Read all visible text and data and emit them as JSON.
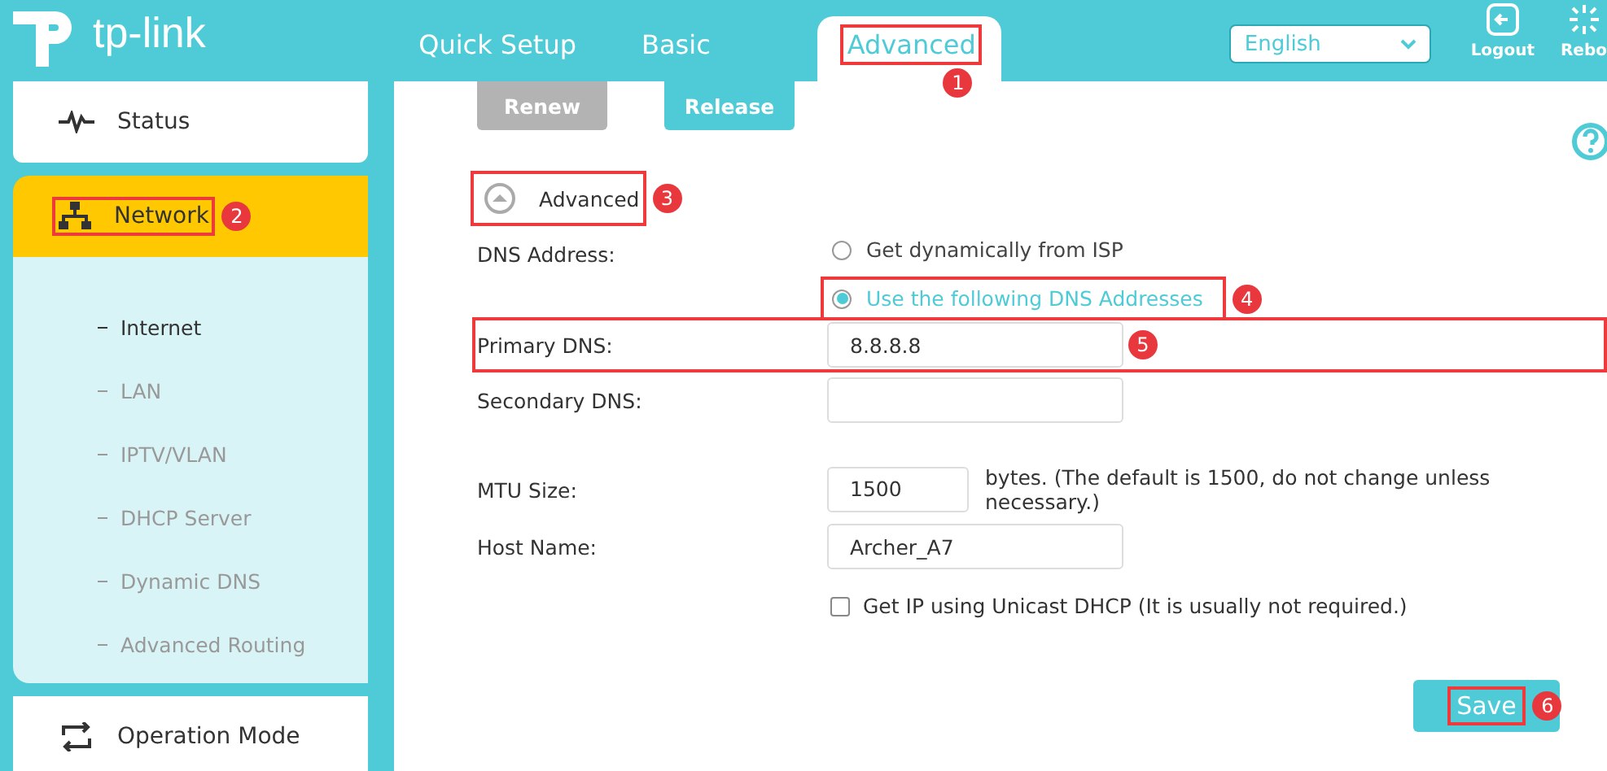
{
  "logo": {
    "text": "tp-link"
  },
  "nav_tabs": [
    {
      "label": "Quick Setup",
      "selected": false
    },
    {
      "label": "Basic",
      "selected": false
    },
    {
      "label": "Advanced",
      "selected": true,
      "annotation": "1"
    }
  ],
  "language": {
    "value": "English"
  },
  "header_actions": [
    {
      "label": "Logout",
      "kind": "logout"
    },
    {
      "label": "Rebo",
      "kind": "reboot"
    }
  ],
  "sidebar": {
    "items": [
      {
        "label": "Status",
        "kind": "status",
        "selected": false
      },
      {
        "label": "Network",
        "kind": "network",
        "selected": true,
        "annotation": "2",
        "children": [
          {
            "label": "Internet",
            "selected": true
          },
          {
            "label": "LAN",
            "selected": false
          },
          {
            "label": "IPTV/VLAN",
            "selected": false
          },
          {
            "label": "DHCP Server",
            "selected": false
          },
          {
            "label": "Dynamic DNS",
            "selected": false
          },
          {
            "label": "Advanced Routing",
            "selected": false
          }
        ]
      },
      {
        "label": "Operation Mode",
        "kind": "mode",
        "selected": false
      }
    ]
  },
  "top_buttons": [
    {
      "label": "Renew",
      "disabled": true
    },
    {
      "label": "Release",
      "disabled": false
    }
  ],
  "advanced_toggle": {
    "label": "Advanced",
    "expanded": true,
    "annotation": "3"
  },
  "dns_address": {
    "label": "DNS Address:",
    "options": [
      {
        "label": "Get dynamically from ISP",
        "selected": false
      },
      {
        "label": "Use the following DNS Addresses",
        "selected": true,
        "annotation": "4"
      }
    ]
  },
  "fields": [
    {
      "label": "Primary DNS:",
      "value": "8.8.8.8",
      "annotation": "5"
    },
    {
      "label": "Secondary DNS:"
    },
    {
      "label": "MTU Size:",
      "value": "1500",
      "note": "bytes. (The default is 1500, do not change unless necessary.)"
    },
    {
      "label": "Host Name:",
      "value": "Archer_A7"
    }
  ],
  "unicast_checkbox": {
    "label": "Get IP using Unicast DHCP (It is usually not required.)",
    "checked": false
  },
  "save_button": {
    "label": "Save",
    "annotation": "6"
  }
}
